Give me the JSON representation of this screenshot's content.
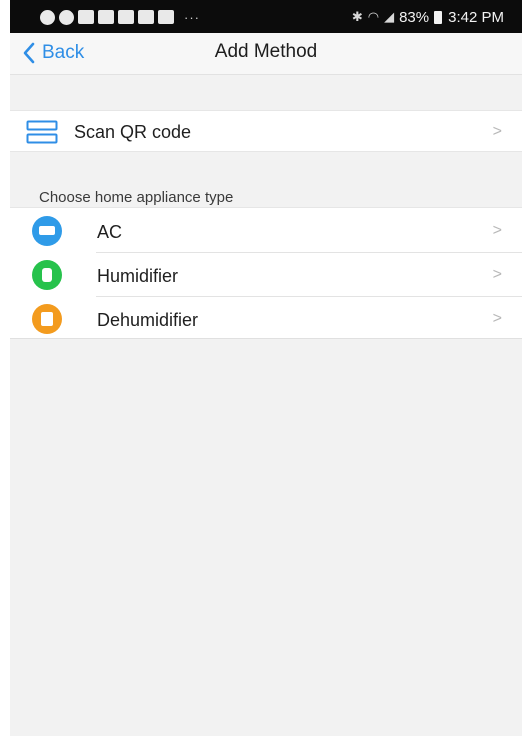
{
  "status_bar": {
    "battery": "83%",
    "time": "3:42 PM",
    "extra": "···"
  },
  "nav": {
    "back_label": "Back",
    "title": "Add Method"
  },
  "scan": {
    "label": "Scan QR code",
    "chevron": ">"
  },
  "appliances": {
    "header": "Choose home appliance type",
    "items": [
      {
        "label": "AC",
        "icon": "ac-icon",
        "color": "#2f9be8",
        "chevron": ">"
      },
      {
        "label": "Humidifier",
        "icon": "humidifier-icon",
        "color": "#27c24c",
        "chevron": ">"
      },
      {
        "label": "Dehumidifier",
        "icon": "dehumidifier-icon",
        "color": "#f39b1e",
        "chevron": ">"
      }
    ]
  },
  "colors": {
    "accent": "#2f8ee6",
    "background": "#f2f2f2"
  }
}
